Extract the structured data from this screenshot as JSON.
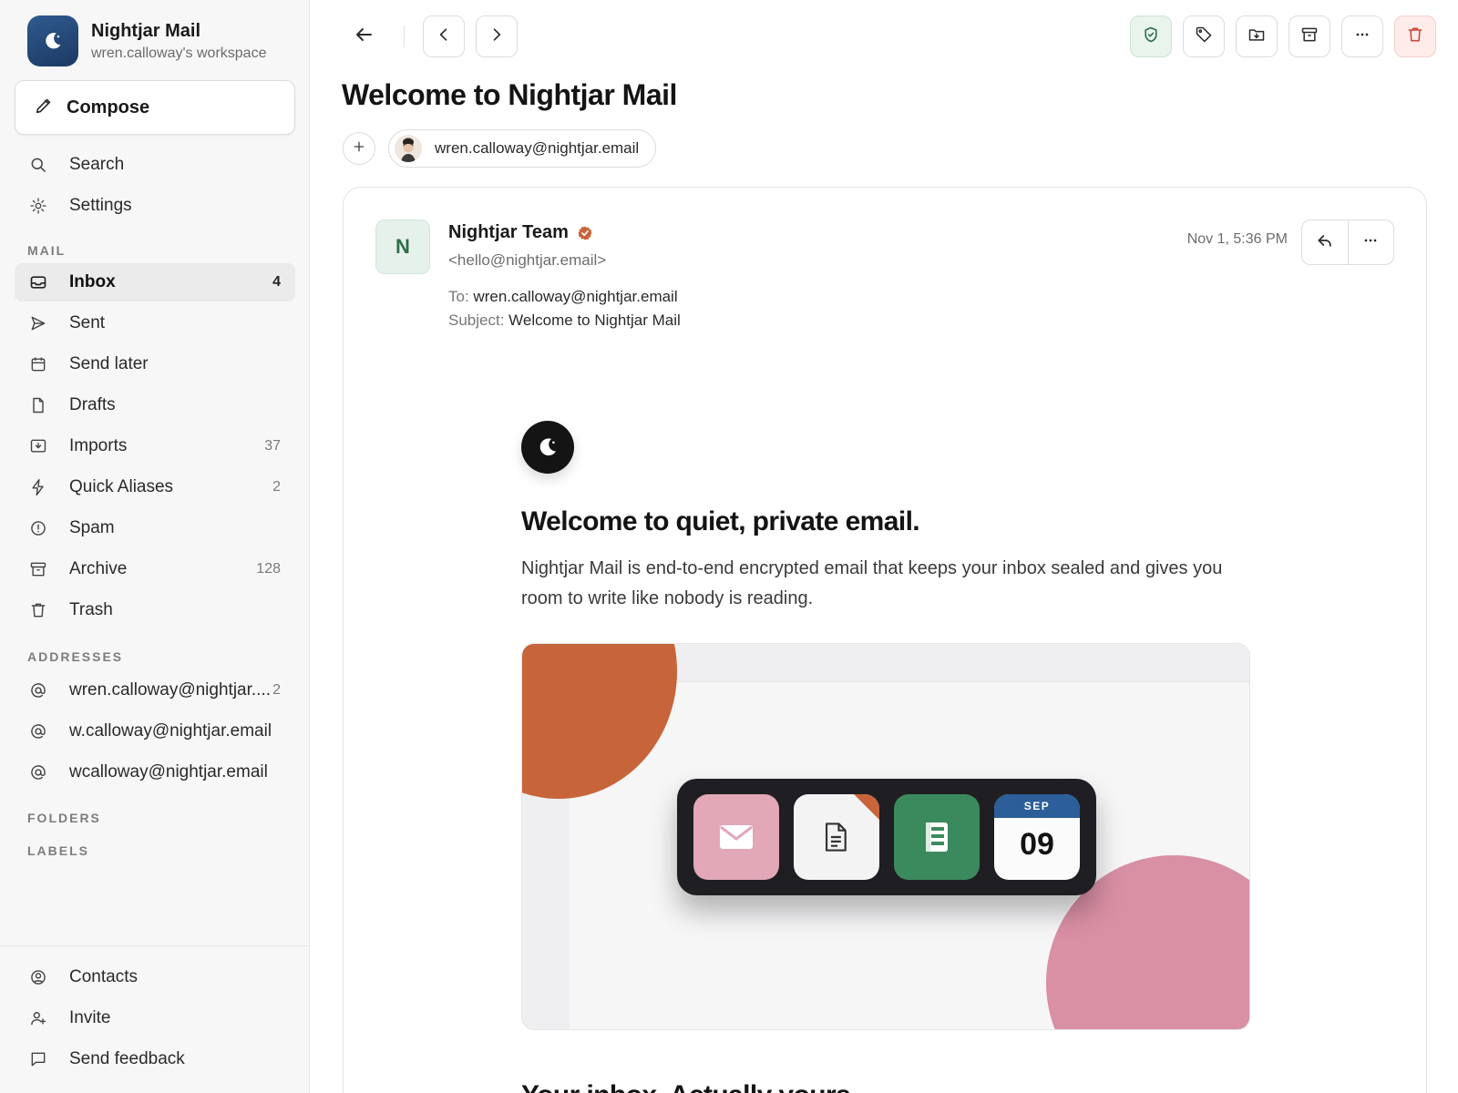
{
  "workspace": {
    "name": "Nightjar Mail",
    "subtitle": "wren.calloway's workspace"
  },
  "sidebar": {
    "compose_label": "Compose",
    "top_items": [
      {
        "label": "Search",
        "icon": "search-icon"
      },
      {
        "label": "Settings",
        "icon": "gear-icon"
      }
    ],
    "mail_section": "MAIL",
    "mail_items": [
      {
        "label": "Inbox",
        "count": "4",
        "icon": "inbox-icon",
        "active": true
      },
      {
        "label": "Sent",
        "count": "",
        "icon": "send-icon"
      },
      {
        "label": "Send later",
        "count": "",
        "icon": "calendar-icon"
      },
      {
        "label": "Drafts",
        "count": "",
        "icon": "file-icon"
      },
      {
        "label": "Imports",
        "count": "37",
        "icon": "import-icon"
      },
      {
        "label": "Quick Aliases",
        "count": "2",
        "icon": "bolt-icon"
      },
      {
        "label": "Spam",
        "count": "",
        "icon": "alert-icon"
      },
      {
        "label": "Archive",
        "count": "128",
        "icon": "archive-icon"
      },
      {
        "label": "Trash",
        "count": "",
        "icon": "trash-icon"
      }
    ],
    "addresses_section": "ADDRESSES",
    "addresses": [
      {
        "label": "wren.calloway@nightjar....",
        "count": "2"
      },
      {
        "label": "w.calloway@nightjar.email",
        "count": ""
      },
      {
        "label": "wcalloway@nightjar.email",
        "count": ""
      }
    ],
    "folders_section": "FOLDERS",
    "labels_section": "LABELS",
    "bottom_items": [
      {
        "label": "Contacts",
        "icon": "contacts-icon"
      },
      {
        "label": "Invite",
        "icon": "user-plus-icon"
      },
      {
        "label": "Send feedback",
        "icon": "message-icon"
      }
    ]
  },
  "thread": {
    "title": "Welcome to Nightjar Mail",
    "recipient_chip": "wren.calloway@nightjar.email"
  },
  "message": {
    "sender_initial": "N",
    "sender_name": "Nightjar Team",
    "sender_email": "<hello@nightjar.email>",
    "to_key": "To:",
    "to_value": "wren.calloway@nightjar.email",
    "subject_key": "Subject:",
    "subject_value": "Welcome to Nightjar Mail",
    "date": "Nov 1, 5:36 PM"
  },
  "email_body": {
    "headline": "Welcome to quiet, private email.",
    "paragraph": "Nightjar Mail is end-to-end encrypted email that keeps your inbox sealed and gives you room to write like nobody is reading.",
    "calendar_month": "SEP",
    "calendar_day": "09",
    "next_heading": "Your inbox. Actually yours."
  },
  "colors": {
    "accent_brand": "#1c3a63",
    "verified": "#c8643a",
    "shield_btn_bg": "#e8f4ec",
    "delete_btn_bg": "#fdecea"
  }
}
